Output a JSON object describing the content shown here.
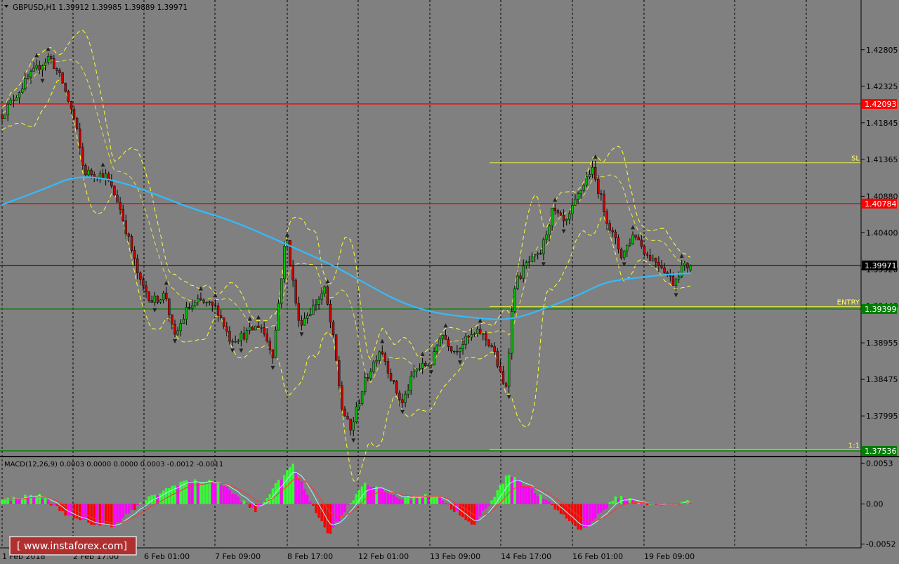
{
  "header": {
    "symbol_line": "GBPUSD,H1  1.39912 1.39985 1.39889 1.39971"
  },
  "macd_label": "MACD(12,26,9) 0.0003 0.0000 0.0000 0.0003 -0.0012 -0.0011",
  "watermark": "[  www.instaforex.com]",
  "colors": {
    "background": "#808080",
    "resistance": "#ff0000",
    "support": "#008000",
    "target_lines": "#e6e64d",
    "moving_average": "#33bbff",
    "bollinger": "#ffff33",
    "current_price": "#000000",
    "macd_green": "#33ff33",
    "macd_magenta": "#ff00ff",
    "macd_red": "#ff0000",
    "signal_cyan": "#99ffff"
  },
  "price_axis": {
    "ticks": [
      "1.42805",
      "1.42325",
      "1.41845",
      "1.41365",
      "1.40880",
      "1.40400",
      "1.39920",
      "1.39440",
      "1.38955",
      "1.38475",
      "1.37995"
    ]
  },
  "macd_axis": {
    "ticks": [
      "0.0053",
      "0.00",
      "-0.0052"
    ]
  },
  "time_axis": {
    "labels": [
      "1 Feb 2018",
      "2 Feb 17:00",
      "6 Feb 01:00",
      "7 Feb 09:00",
      "8 Feb 17:00",
      "12 Feb 01:00",
      "13 Feb 09:00",
      "14 Feb 17:00",
      "16 Feb 01:00",
      "19 Feb 09:00"
    ]
  },
  "chart_data": {
    "type": "candlestick",
    "symbol": "GBPUSD",
    "timeframe": "H1",
    "ohlc_current": {
      "open": 1.39912,
      "high": 1.39985,
      "low": 1.39889,
      "close": 1.39971
    },
    "price_range": [
      1.3748,
      1.4343
    ],
    "horizontal_levels": [
      {
        "price": 1.42093,
        "label": "1.42093",
        "color": "#ff0000"
      },
      {
        "price": 1.40784,
        "label": "1.40784",
        "color": "#ff0000"
      },
      {
        "price": 1.39399,
        "label": "1.39399",
        "color": "#008000"
      },
      {
        "price": 1.37536,
        "label": "1.37536",
        "color": "#008000"
      },
      {
        "price": 1.39971,
        "label": "1.39971",
        "color": "#000000"
      }
    ],
    "annotations": [
      {
        "text": "SL",
        "price": 1.4132
      },
      {
        "text": "ENTRY",
        "price": 1.3943
      },
      {
        "text": "1:1",
        "price": 1.3755
      }
    ],
    "close_path": [
      [
        0,
        1.4195
      ],
      [
        0.03,
        1.4243
      ],
      [
        0.055,
        1.4272
      ],
      [
        0.07,
        1.4238
      ],
      [
        0.085,
        1.4185
      ],
      [
        0.095,
        1.412
      ],
      [
        0.12,
        1.4115
      ],
      [
        0.135,
        1.408
      ],
      [
        0.15,
        1.402
      ],
      [
        0.16,
        1.3975
      ],
      [
        0.175,
        1.395
      ],
      [
        0.19,
        1.396
      ],
      [
        0.2,
        1.39
      ],
      [
        0.215,
        1.394
      ],
      [
        0.23,
        1.395
      ],
      [
        0.25,
        1.394
      ],
      [
        0.265,
        1.39
      ],
      [
        0.28,
        1.3905
      ],
      [
        0.3,
        1.392
      ],
      [
        0.315,
        1.388
      ],
      [
        0.33,
        1.404
      ],
      [
        0.345,
        1.392
      ],
      [
        0.36,
        1.394
      ],
      [
        0.375,
        1.3965
      ],
      [
        0.385,
        1.39
      ],
      [
        0.395,
        1.381
      ],
      [
        0.405,
        1.378
      ],
      [
        0.42,
        1.384
      ],
      [
        0.44,
        1.389
      ],
      [
        0.455,
        1.384
      ],
      [
        0.465,
        1.3815
      ],
      [
        0.48,
        1.386
      ],
      [
        0.5,
        1.387
      ],
      [
        0.51,
        1.391
      ],
      [
        0.525,
        1.3885
      ],
      [
        0.54,
        1.39
      ],
      [
        0.555,
        1.391
      ],
      [
        0.57,
        1.389
      ],
      [
        0.585,
        1.383
      ],
      [
        0.595,
        1.397
      ],
      [
        0.61,
        1.4
      ],
      [
        0.625,
        1.401
      ],
      [
        0.64,
        1.407
      ],
      [
        0.655,
        1.405
      ],
      [
        0.67,
        1.409
      ],
      [
        0.685,
        1.4125
      ],
      [
        0.695,
        1.409
      ],
      [
        0.705,
        1.405
      ],
      [
        0.72,
        1.401
      ],
      [
        0.735,
        1.404
      ],
      [
        0.75,
        1.401
      ],
      [
        0.765,
        1.4
      ],
      [
        0.78,
        1.3975
      ],
      [
        0.79,
        1.3995
      ],
      [
        0.8,
        1.3997
      ]
    ],
    "moving_average": [
      [
        0,
        1.4077
      ],
      [
        0.05,
        1.4098
      ],
      [
        0.085,
        1.4115
      ],
      [
        0.13,
        1.411
      ],
      [
        0.18,
        1.409
      ],
      [
        0.22,
        1.4072
      ],
      [
        0.27,
        1.4055
      ],
      [
        0.33,
        1.4025
      ],
      [
        0.38,
        1.4
      ],
      [
        0.42,
        1.3975
      ],
      [
        0.46,
        1.395
      ],
      [
        0.5,
        1.3935
      ],
      [
        0.55,
        1.3928
      ],
      [
        0.59,
        1.3925
      ],
      [
        0.63,
        1.394
      ],
      [
        0.67,
        1.3958
      ],
      [
        0.7,
        1.3975
      ],
      [
        0.73,
        1.398
      ],
      [
        0.77,
        1.3985
      ],
      [
        0.8,
        1.3987
      ]
    ],
    "macd_range": [
      -0.0055,
      0.0057
    ],
    "macd_histogram_sample": [
      0.0005,
      0.0012,
      -0.002,
      -0.003,
      0.0006,
      0.003,
      0.0028,
      -0.001,
      0.0052,
      -0.004,
      0.0028,
      0.0007,
      0.0012,
      -0.003,
      0.004,
      0.0005,
      -0.0035,
      0.001,
      -0.0002,
      0.0003
    ]
  }
}
